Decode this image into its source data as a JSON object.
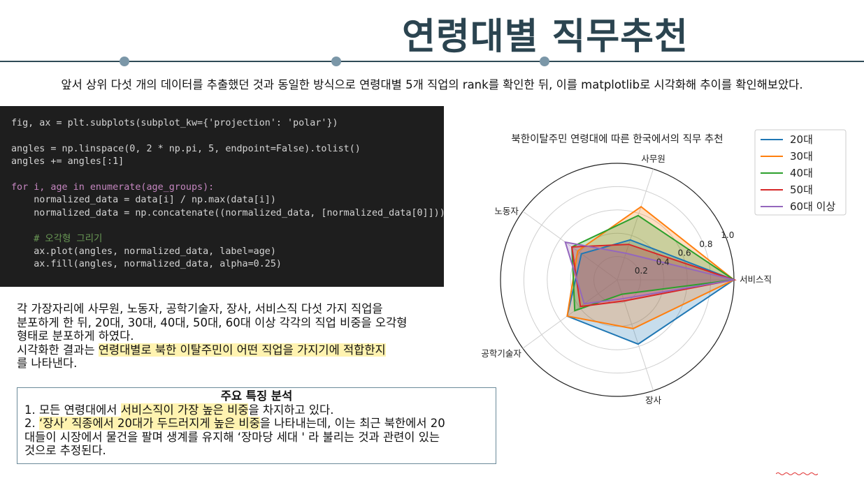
{
  "slide": {
    "title": "연령대별 직무추천",
    "intro": "앞서 상위 다섯 개의 데이터를 추출했던 것과 동일한 방식으로 연령대별 5개 직업의 rank를 확인한 뒤, 이를 matplotlib로 시각화해 추이를 확인해보았다.",
    "desc": {
      "line1": "각 가장자리에 사무원, 노동자, 공학기술자, 장사, 서비스직 다섯 가지 직업을",
      "line2": "분포하게 한 뒤, 20대, 30대, 40대, 50대, 60대 이상 각각의 직업 비중을 오각형",
      "line3": "형태로 분포하게 하였다.",
      "line4a": "시각화한 결과는 ",
      "line4b": "연령대별로 북한 이탈주민이 어떤 직업을 가지기에 적합한지",
      "line5": "를 나타낸다."
    },
    "box": {
      "title": "주요 특징 분석",
      "p1a": "1. 모든 연령대에서 ",
      "p1b": "서비스직이 가장 높은 비중",
      "p1c": "을 차지하고 있다.",
      "p2a": "2. ",
      "p2b": "‘장사’ 직종에서 20대가 두드러지게 높은 비중",
      "p2c": "을 나타내는데, 이는 최근 북한에서 20",
      "p2d": "대들이 시장에서 물건을 팔며 생계를 유지해 ‘장마당 세대 ' 라 불리는 것과 관련이 있는",
      "p2e": "것으로 추정된다."
    }
  },
  "code": {
    "l1": "fig, ax = plt.subplots(subplot_kw={'projection': 'polar'})",
    "l2": "angles = np.linspace(0, 2 * np.pi, 5, endpoint=False).tolist()",
    "l3": "angles += angles[:1]",
    "l4": "for i, age in enumerate(age_groups):",
    "l5": "    normalized_data = data[i] / np.max(data[i])",
    "l6": "    normalized_data = np.concatenate((normalized_data, [normalized_data[0]]))",
    "l7": "    # 오각형 그리기",
    "l8": "    ax.plot(angles, normalized_data, label=age)",
    "l9": "    ax.fill(angles, normalized_data, alpha=0.25)"
  },
  "chart_data": {
    "type": "radar",
    "title": "북한이탈주민 연령대에 따른 한국에서의 직무 추천",
    "categories": [
      "서비스직",
      "사무원",
      "노동자",
      "공학기술자",
      "장사"
    ],
    "rlim": [
      0,
      1.0
    ],
    "rticks": [
      "0.2",
      "0.4",
      "0.6",
      "0.8",
      "1.0"
    ],
    "rtick_values": [
      0.2,
      0.4,
      0.6,
      0.8,
      1.0
    ],
    "grid": true,
    "legend_position": "top-right",
    "series": [
      {
        "name": "20대",
        "color": "#1f77b4",
        "values": [
          1.0,
          0.36,
          0.38,
          0.53,
          0.58
        ]
      },
      {
        "name": "30대",
        "color": "#ff7f0e",
        "values": [
          1.0,
          0.66,
          0.42,
          0.53,
          0.44
        ]
      },
      {
        "name": "40대",
        "color": "#2ca02c",
        "values": [
          1.0,
          0.58,
          0.48,
          0.45,
          0.13
        ]
      },
      {
        "name": "50대",
        "color": "#d62728",
        "values": [
          1.0,
          0.32,
          0.48,
          0.39,
          0.19
        ]
      },
      {
        "name": "60대 이상",
        "color": "#9467bd",
        "values": [
          1.0,
          0.24,
          0.55,
          0.35,
          0.17
        ]
      }
    ]
  }
}
